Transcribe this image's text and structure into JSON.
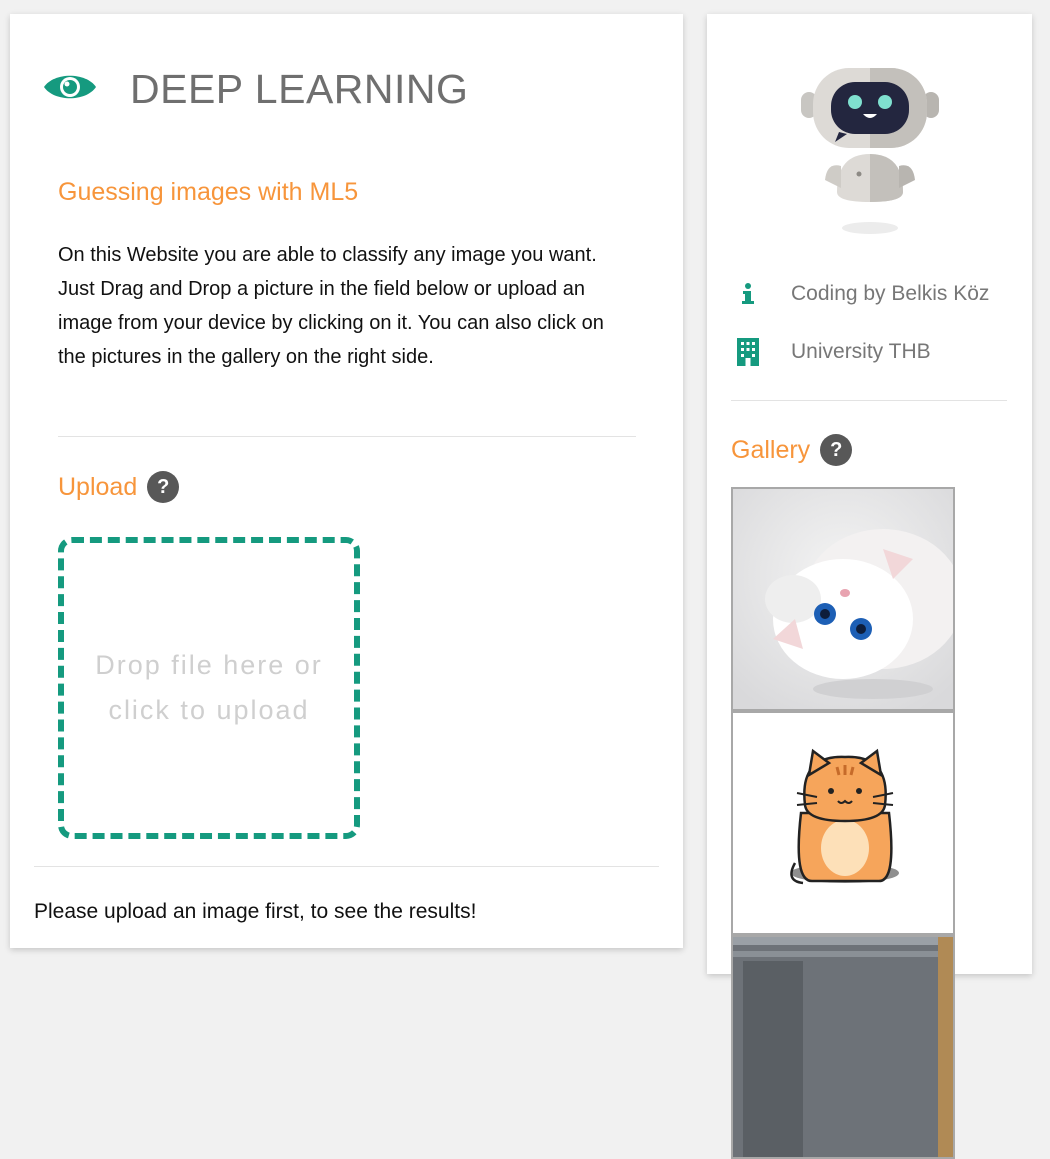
{
  "header": {
    "title": "DEEP LEARNING",
    "icon": "eye-icon",
    "accent": "#159a7f"
  },
  "intro": {
    "heading": "Guessing images with ML5",
    "text": "On this Website you are able to classify any image you want. Just Drag and Drop a picture in the field below or upload an image from your device by clicking on it. You can also click on the pictures in the gallery on the right side."
  },
  "upload": {
    "heading": "Upload",
    "help_label": "?",
    "dropzone_text": "Drop file here or click to upload"
  },
  "result": {
    "message": "Please upload an image first, to see the results!"
  },
  "sidebar": {
    "avatar": "robot-icon",
    "info": [
      {
        "icon": "info-icon",
        "label": "Coding by Belkis Köz"
      },
      {
        "icon": "building-icon",
        "label": "University THB"
      }
    ],
    "gallery": {
      "heading": "Gallery",
      "help_label": "?",
      "images": [
        {
          "name": "white-kitten-photo"
        },
        {
          "name": "cartoon-cat-drawing"
        },
        {
          "name": "building-photo"
        }
      ]
    }
  },
  "colors": {
    "accent": "#159a7f",
    "heading": "#f7953b",
    "title": "#6f6f6f"
  }
}
